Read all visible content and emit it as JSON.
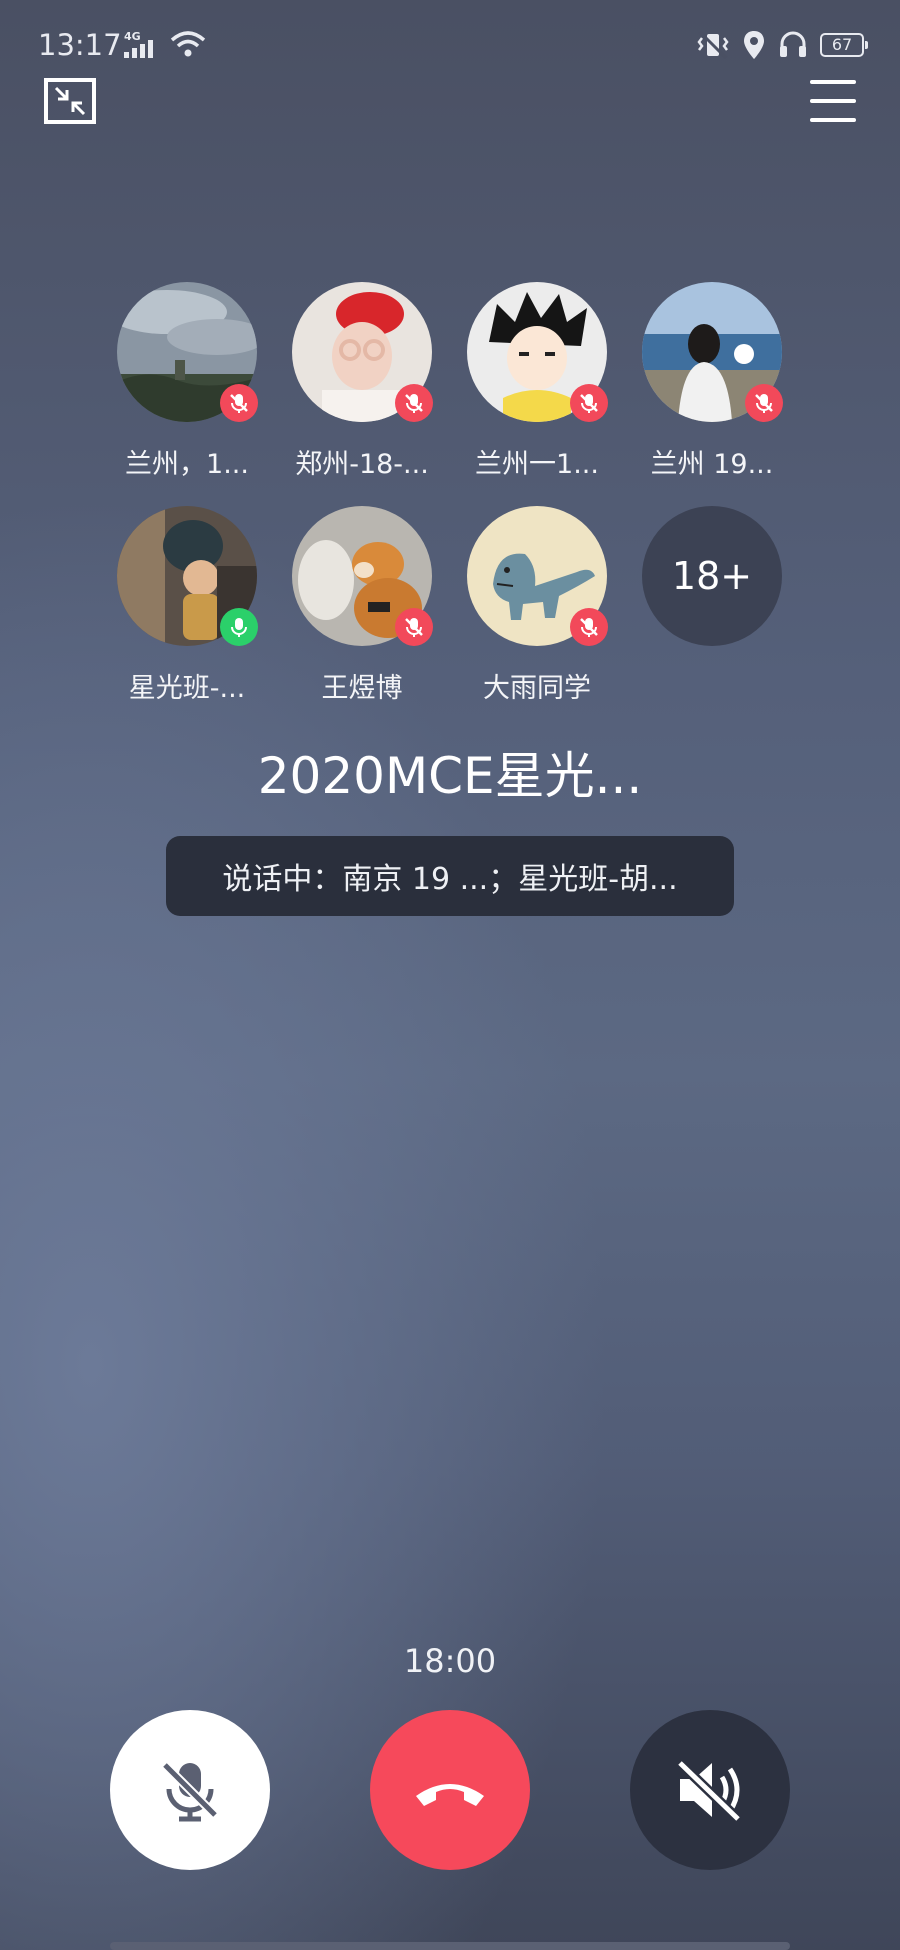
{
  "status": {
    "time": "13:17",
    "network": "4G",
    "battery": "67",
    "icons": [
      "signal-icon",
      "wifi-icon",
      "vibrate-icon",
      "location-icon",
      "headset-icon",
      "battery-icon"
    ]
  },
  "toolbar": {
    "minimize_icon": "minimize-icon",
    "menu_icon": "menu-icon"
  },
  "participants": [
    {
      "name": "兰州，1...",
      "mic": "muted",
      "avatar": "sky-tree-photo"
    },
    {
      "name": "郑州-18-...",
      "mic": "muted",
      "avatar": "girl-red-hat-photo"
    },
    {
      "name": "兰州一1...",
      "mic": "muted",
      "avatar": "anime-boy-drawing"
    },
    {
      "name": "兰州  19...",
      "mic": "muted",
      "avatar": "seaside-girl-photo"
    },
    {
      "name": "星光班-...",
      "mic": "speaking",
      "avatar": "child-statue-photo"
    },
    {
      "name": "王煜博",
      "mic": "muted",
      "avatar": "shiba-dog-photo"
    },
    {
      "name": "大雨同学",
      "mic": "muted",
      "avatar": "dinosaur-drawing"
    }
  ],
  "more_count": "18+",
  "group_title": "2020MCE星光...",
  "speaking_text": "说话中：南京 19 ...；星光班-胡...",
  "call_timer": "18:00",
  "controls": {
    "mic": "mic-muted-icon",
    "hangup": "hangup-icon",
    "speaker": "speaker-muted-icon"
  },
  "colors": {
    "muted_badge": "#f2495a",
    "speaking_badge": "#2bd06a",
    "hangup": "#f6495b"
  }
}
